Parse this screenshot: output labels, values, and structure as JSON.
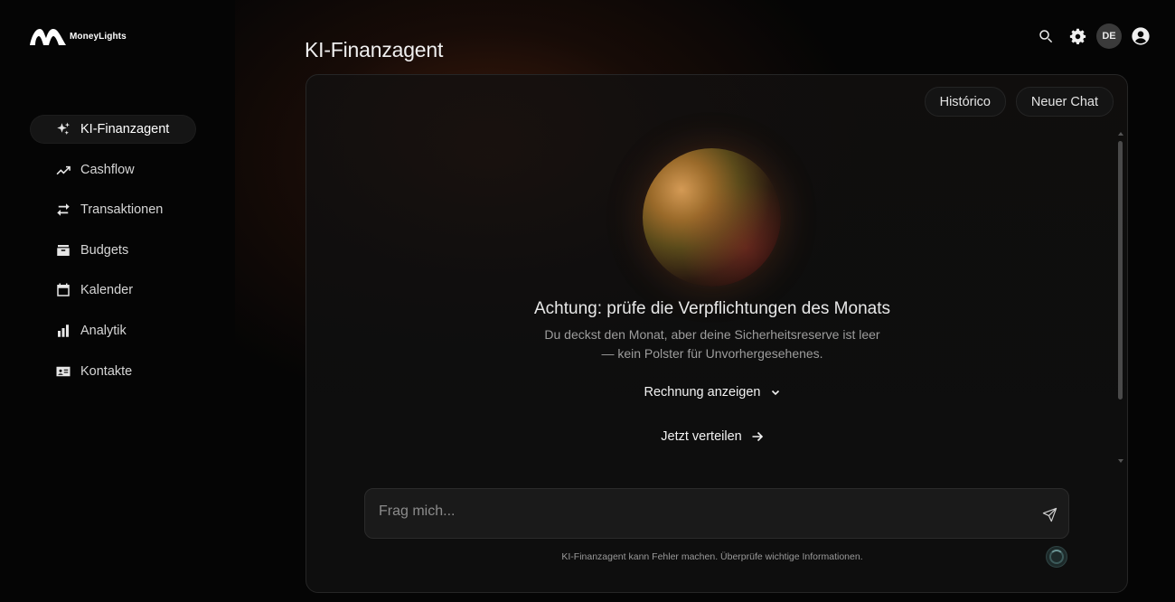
{
  "app": {
    "brand_name": "MoneyLights",
    "page_title": "KI-Finanzagent",
    "language_code": "DE"
  },
  "sidebar": {
    "items": [
      {
        "label": "KI-Finanzagent",
        "icon": "sparkles-icon",
        "active": true
      },
      {
        "label": "Cashflow",
        "icon": "trending-up-icon",
        "active": false
      },
      {
        "label": "Transaktionen",
        "icon": "swap-arrows-icon",
        "active": false
      },
      {
        "label": "Budgets",
        "icon": "archive-box-icon",
        "active": false
      },
      {
        "label": "Kalender",
        "icon": "calendar-icon",
        "active": false
      },
      {
        "label": "Analytik",
        "icon": "bar-chart-icon",
        "active": false
      },
      {
        "label": "Kontakte",
        "icon": "contact-card-icon",
        "active": false
      }
    ]
  },
  "header": {
    "icons": [
      "search-icon",
      "gear-icon",
      "language-badge",
      "user-account-icon"
    ]
  },
  "chat": {
    "history_button": "Histórico",
    "new_chat_button": "Neuer Chat",
    "alert_title": "Achtung: prüfe die Verpflichtungen des Monats",
    "alert_body_line1": "Du deckst den Monat, aber deine Sicherheitsreserve ist leer",
    "alert_body_line2": "— kein Polster für Unvorhergesehenes.",
    "show_bill_label": "Rechnung anzeigen",
    "distribute_label": "Jetzt verteilen",
    "input_placeholder": "Frag mich...",
    "disclaimer": "KI-Finanzagent kann Fehler machen. Überprüfe wichtige Informationen."
  },
  "colors": {
    "background": "#050505",
    "panel": "#0e0e0e",
    "glow": "#78301a",
    "text_primary": "#e8e8e8",
    "text_muted": "#9d9d9d"
  }
}
